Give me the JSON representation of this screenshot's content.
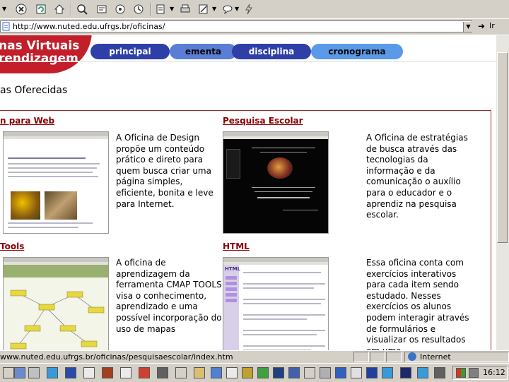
{
  "browser": {
    "address": "http://www.nuted.edu.ufrgs.br/oficinas/",
    "go_label": "Ir",
    "status_text": "www.nuted.edu.ufrgs.br/oficinas/pesquisaescolar/index.htm",
    "zone_text": "Internet",
    "toolbar_icons": [
      "back-icon",
      "stop-icon",
      "refresh-icon",
      "home-icon",
      "search-icon",
      "favorites-icon",
      "media-icon",
      "history-icon",
      "mail-icon",
      "print-icon",
      "edit-icon",
      "discuss-icon",
      "messenger-icon"
    ]
  },
  "site": {
    "logo_line1": "nas Virtuais",
    "logo_line2": "rendizagem",
    "nav": [
      "principal",
      "ementa",
      "disciplina",
      "cronograma"
    ],
    "section_title": "as Oferecidas",
    "cards": [
      {
        "title": "n para Web",
        "description": "A Oficina de Design propõe um conteúdo prático e direto para quem busca criar uma página simples, eficiente, bonita e leve para Internet."
      },
      {
        "title": "Pesquisa Escolar",
        "description": "A Oficina de estratégias de busca através das tecnologias da informação e da comunicação o auxílio para o educador e o aprendiz na pesquisa escolar."
      },
      {
        "title": "Tools",
        "description": "A oficina de aprendizagem da ferramenta CMAP TOOLS visa o conhecimento, aprendizado e uma possível incorporação do uso de mapas"
      },
      {
        "title": "HTML",
        "description": "Essa oficina conta com exercícios interativos para cada item sendo estudado. Nesses exercícios os alunos podem interagir através de formulários e visualizar os resultados em uma"
      }
    ],
    "thumb_html_label": "HTML"
  },
  "taskbar": {
    "clock": "16:12"
  },
  "colors": {
    "accent_red": "#c21f2a",
    "card_title": "#8b0000",
    "nav_dark": "#2f3fa8",
    "nav_light": "#5a7ed6"
  }
}
